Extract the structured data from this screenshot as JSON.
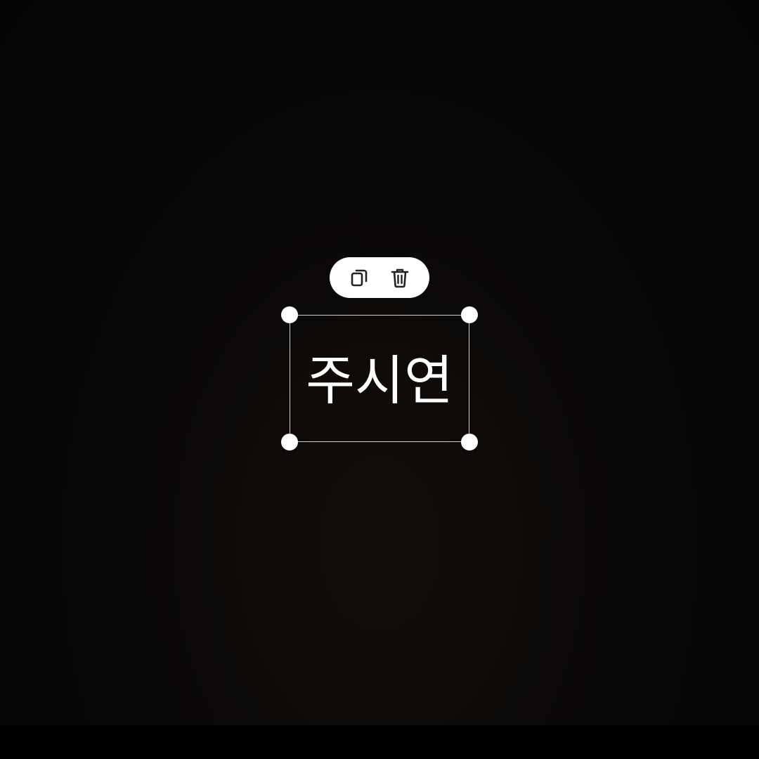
{
  "canvas": {
    "background_color": "#0a0807"
  },
  "toolbar": {
    "duplicate_icon": "duplicate-icon",
    "delete_icon": "trash-icon"
  },
  "text_object": {
    "text": "주시연",
    "color": "#ffffff"
  },
  "handles": {
    "color": "#ffffff"
  }
}
